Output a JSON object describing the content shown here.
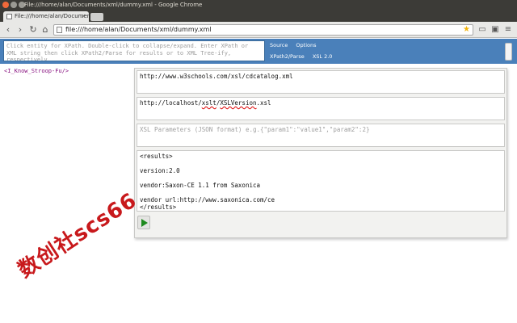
{
  "window": {
    "title": "File:///home/alan/Documents/xml/dummy.xml - Google Chrome"
  },
  "tabs": [
    {
      "label": "File:///home/alan/Documents",
      "close_glyph": "×"
    }
  ],
  "toolbar": {
    "url": "file:///home/alan/Documents/xml/dummy.xml",
    "back_glyph": "‹",
    "forward_glyph": "›",
    "reload_glyph": "↻",
    "home_glyph": "⌂"
  },
  "extension": {
    "xpath_placeholder": "Click entity for XPath. Double-click to collapse/expand. Enter XPath or XML string then click XPath2/Parse for results or to XML Tree-ify, respectively.",
    "links_row1": [
      "Source",
      "Options"
    ],
    "links_row2": [
      "XPath2/Parse",
      "XSL 2.0"
    ]
  },
  "page": {
    "xml_text": "<I_Know_Stroop-Fu/>"
  },
  "panel": {
    "xml_url": "http://www.w3schools.com/xsl/cdcatalog.xml",
    "xsl_url_prefix": "http://localhost/",
    "xsl_url_word1": "xslt",
    "xsl_url_sep": "/",
    "xsl_url_word2": "XSLVersion",
    "xsl_url_suffix": ".xsl",
    "params_placeholder": "XSL Parameters (JSON format) e.g.{\"param1\":\"value1\",\"param2\":2}",
    "results": "<results>\n\nversion:2.0\n\nvendor:Saxon-CE 1.1 from Saxonica\n\nvendor url:http://www.saxonica.com/ce\n</results>"
  },
  "watermark": "数创社scs66"
}
